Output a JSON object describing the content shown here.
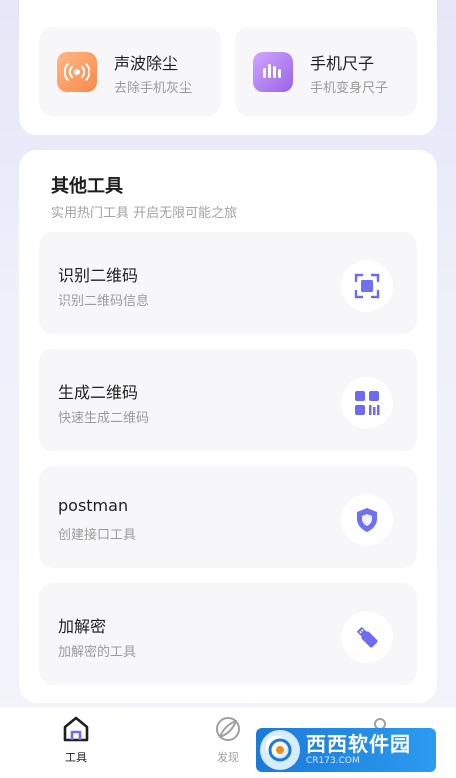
{
  "top_tools": [
    {
      "title": "声波除尘",
      "subtitle": "去除手机灰尘",
      "icon": "sound-wave-icon",
      "color": "#f7894a"
    },
    {
      "title": "手机尺子",
      "subtitle": "手机变身尺子",
      "icon": "ruler-icon",
      "color": "#9a63e8"
    }
  ],
  "other_tools": {
    "title": "其他工具",
    "subtitle": "实用热门工具 开启无限可能之旅",
    "items": [
      {
        "title": "识别二维码",
        "subtitle": "识别二维码信息",
        "icon": "scan-qr-icon"
      },
      {
        "title": "生成二维码",
        "subtitle": "快速生成二维码",
        "icon": "qr-code-icon"
      },
      {
        "title": "postman",
        "subtitle": "创建接口工具",
        "icon": "shield-icon"
      },
      {
        "title": "加解密",
        "subtitle": "加解密的工具",
        "icon": "usb-key-icon"
      }
    ]
  },
  "tabbar": {
    "tabs": [
      {
        "label": "工具",
        "icon": "home-icon",
        "active": true
      },
      {
        "label": "发现",
        "icon": "compass-icon",
        "active": false
      },
      {
        "label": "",
        "icon": "profile-icon",
        "active": false
      }
    ]
  },
  "watermark": {
    "text": "西西软件园",
    "subtext": "CR173.COM"
  },
  "colors": {
    "accent": "#6b6cf0",
    "active_tab": "#1f1f1f",
    "inactive_tab": "#a0a0a0"
  }
}
